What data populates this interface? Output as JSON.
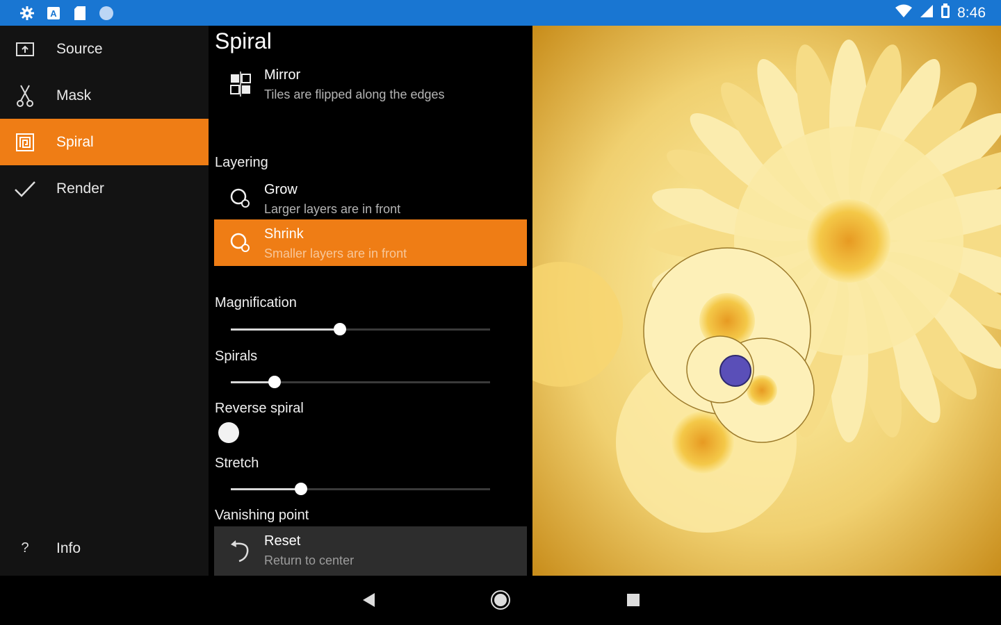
{
  "status_bar": {
    "time": "8:46",
    "left_icons": [
      "settings-icon",
      "app-a-icon",
      "sd-card-icon",
      "circle-icon"
    ],
    "right_icons": [
      "wifi-icon",
      "signal-icon",
      "battery-icon"
    ]
  },
  "nav": {
    "items": [
      {
        "label": "Source",
        "icon": "source-icon"
      },
      {
        "label": "Mask",
        "icon": "scissors-icon"
      },
      {
        "label": "Spiral",
        "icon": "spiral-icon",
        "active": true
      },
      {
        "label": "Render",
        "icon": "check-icon"
      }
    ],
    "info_label": "Info",
    "info_icon_glyph": "?"
  },
  "panel": {
    "title": "Spiral",
    "mirror": {
      "title": "Mirror",
      "subtitle": "Tiles are flipped along the edges"
    },
    "layering_label": "Layering",
    "grow": {
      "title": "Grow",
      "subtitle": "Larger layers are in front"
    },
    "shrink": {
      "title": "Shrink",
      "subtitle": "Smaller layers are in front"
    },
    "magnification_label": "Magnification",
    "magnification_value": 0.42,
    "spirals_label": "Spirals",
    "spirals_value": 0.17,
    "reverse_label": "Reverse spiral",
    "stretch_label": "Stretch",
    "stretch_value": 0.27,
    "vanishing_label": "Vanishing point",
    "reset": {
      "title": "Reset",
      "subtitle": "Return to center"
    }
  },
  "colors": {
    "accent": "#ef7d15",
    "status_bar": "#1976d2",
    "vanishing_point_marker": "#5a4fb8"
  }
}
